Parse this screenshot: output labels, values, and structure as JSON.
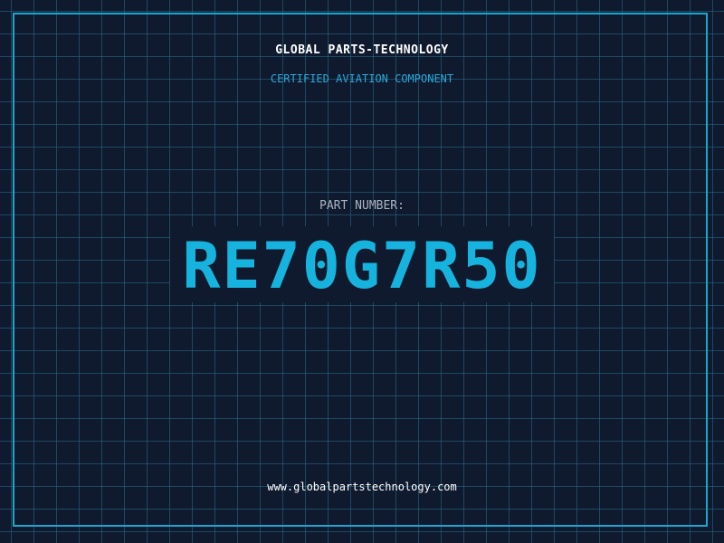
{
  "header": {
    "company": "GLOBAL PARTS-TECHNOLOGY",
    "subtitle": "CERTIFIED AVIATION COMPONENT"
  },
  "part": {
    "label": "PART NUMBER:",
    "number": "RE70G7R50"
  },
  "footer": {
    "website": "www.globalpartstechnology.com"
  },
  "colors": {
    "background": "#101a2e",
    "grid": "#286e8c",
    "frame": "#1aa6cf",
    "accent": "#16b3de",
    "label": "#a9b4c4",
    "text": "#ffffff"
  }
}
